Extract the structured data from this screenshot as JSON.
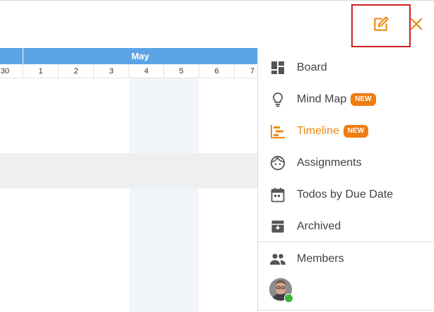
{
  "toolbar": {
    "edit_icon": "edit-note-icon",
    "close_icon": "close-icon",
    "accent_color": "#ef8a14",
    "highlight_outline_color": "#cc1f1f"
  },
  "timeline": {
    "month": "May",
    "days": [
      "30",
      "1",
      "2",
      "3",
      "4",
      "5",
      "6",
      "7"
    ],
    "header_color": "#5da4e6"
  },
  "sidebar": {
    "items": [
      {
        "label": "Board",
        "icon": "board-icon",
        "badge": ""
      },
      {
        "label": "Mind Map",
        "icon": "lightbulb-icon",
        "badge": "NEW"
      },
      {
        "label": "Timeline",
        "icon": "timeline-icon",
        "badge": "NEW",
        "active": true
      },
      {
        "label": "Assignments",
        "icon": "face-icon",
        "badge": ""
      },
      {
        "label": "Todos by Due Date",
        "icon": "calendar-icon",
        "badge": ""
      },
      {
        "label": "Archived",
        "icon": "archive-icon",
        "badge": ""
      }
    ],
    "members": {
      "label": "Members",
      "icon": "people-icon",
      "avatar_status": "online"
    },
    "badge_color": "#ef7d12"
  }
}
